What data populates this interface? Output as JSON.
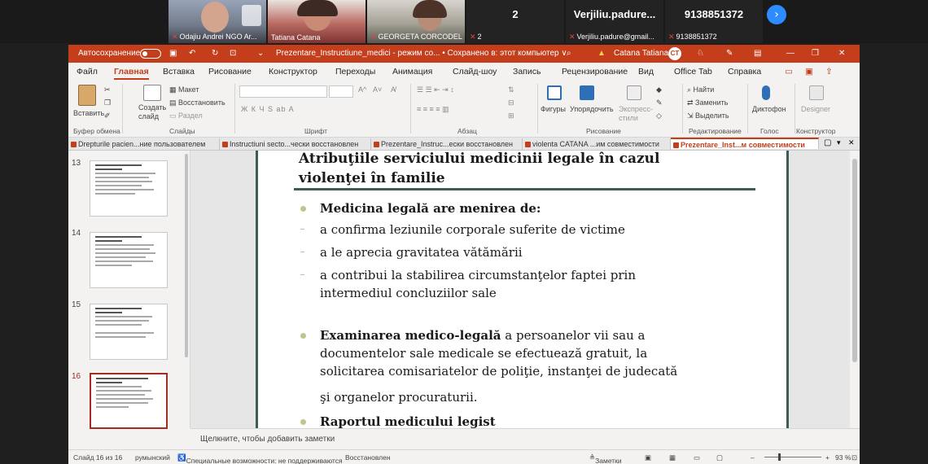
{
  "zoom": {
    "participants": [
      {
        "name": "Odajiu Andrei NGO Ar..."
      },
      {
        "name": "Tatiana Catana"
      },
      {
        "name": "GEORGETA CORCODEL"
      },
      {
        "name": "2",
        "big": "2"
      },
      {
        "name": "Verjiliu.padure@gmail...",
        "big": "Verjiliu.padure..."
      },
      {
        "name": "9138851372",
        "big": "9138851372"
      }
    ],
    "next_icon": "chevron-right"
  },
  "titlebar": {
    "autosave": "Автосохранение",
    "file_title": "Prezentare_Instructiune_medici  -  режим со...  •  Сохранено в: этот компьютер ∨",
    "warn_icon": "warning-icon",
    "user": "Catana Tatiana",
    "initials": "CT"
  },
  "menu": [
    "Файл",
    "Главная",
    "Вставка",
    "Рисование",
    "Конструктор",
    "Переходы",
    "Анимация",
    "Слайд-шоу",
    "Запись",
    "Рецензирование",
    "Вид",
    "Office Tab",
    "Справка"
  ],
  "ribbon": {
    "paste": "Вставить",
    "create_slide": "Создать\nслайд",
    "layout": "Макет",
    "reset": "Восстановить",
    "section": "Раздел",
    "groups": [
      "Буфер обмена",
      "Слайды",
      "Шрифт",
      "Абзац",
      "Рисование",
      "Редактирование",
      "Голос",
      "Конструктор"
    ],
    "shapes": "Фигуры",
    "arrange": "Упорядочить",
    "quick_styles": "Экспресс-\nстили",
    "find": "Найти",
    "replace": "Заменить",
    "select": "Выделить",
    "dictate": "Диктофон",
    "designer": "Designer",
    "font_buttons": "Ж  К  Ч  S  ab  A",
    "font_size_up": "A^",
    "font_size_down": "A˅"
  },
  "doc_tabs": [
    "Drepturile pacien...ние пользователем",
    "Instructiuni secto...чески восстановлен",
    "Prezentare_Instruc...ески восстановлен",
    "violenta CATANA  ...им совместимости",
    "Prezentare_Inst...м совместимости"
  ],
  "thumbnails": [
    {
      "num": "13"
    },
    {
      "num": "14"
    },
    {
      "num": "15"
    },
    {
      "num": "16"
    }
  ],
  "slide": {
    "title_line1": "Atribuţiile serviciului medicinii legale în cazul",
    "title_line2": "violenţei în familie",
    "b1": "Medicina legală are menirea de:",
    "s1": "a confirma leziunile corporale suferite de victime",
    "s2": "a le aprecia gravitatea vătămării",
    "s3a": "a contribui la stabilirea circumstanţelor faptei prin",
    "s3b": "intermediul concluziilor sale",
    "b2_bold": "Examinarea medico-legală",
    "b2_l1": " a persoanelor vii sau a",
    "b2_l2": "documentelor sale medicale se efectuează gratuit, la",
    "b2_l3": "solicitarea comisariatelor de poliţie, instanţei de judecată",
    "b2_l4": "şi organelor procuraturii.",
    "b3": "Raportul medicului legist"
  },
  "notes": "Щелкните, чтобы добавить заметки",
  "status": {
    "slide": "Слайд 16 из 16",
    "lang": "румынский",
    "access": "Специальные возможности: не поддерживаются",
    "recovered": "Восстановлен",
    "notes_btn": "Заметки",
    "zoom": "93 %"
  },
  "colors": {
    "accent": "#c43e1c",
    "slide_rule": "#3d5c58"
  }
}
